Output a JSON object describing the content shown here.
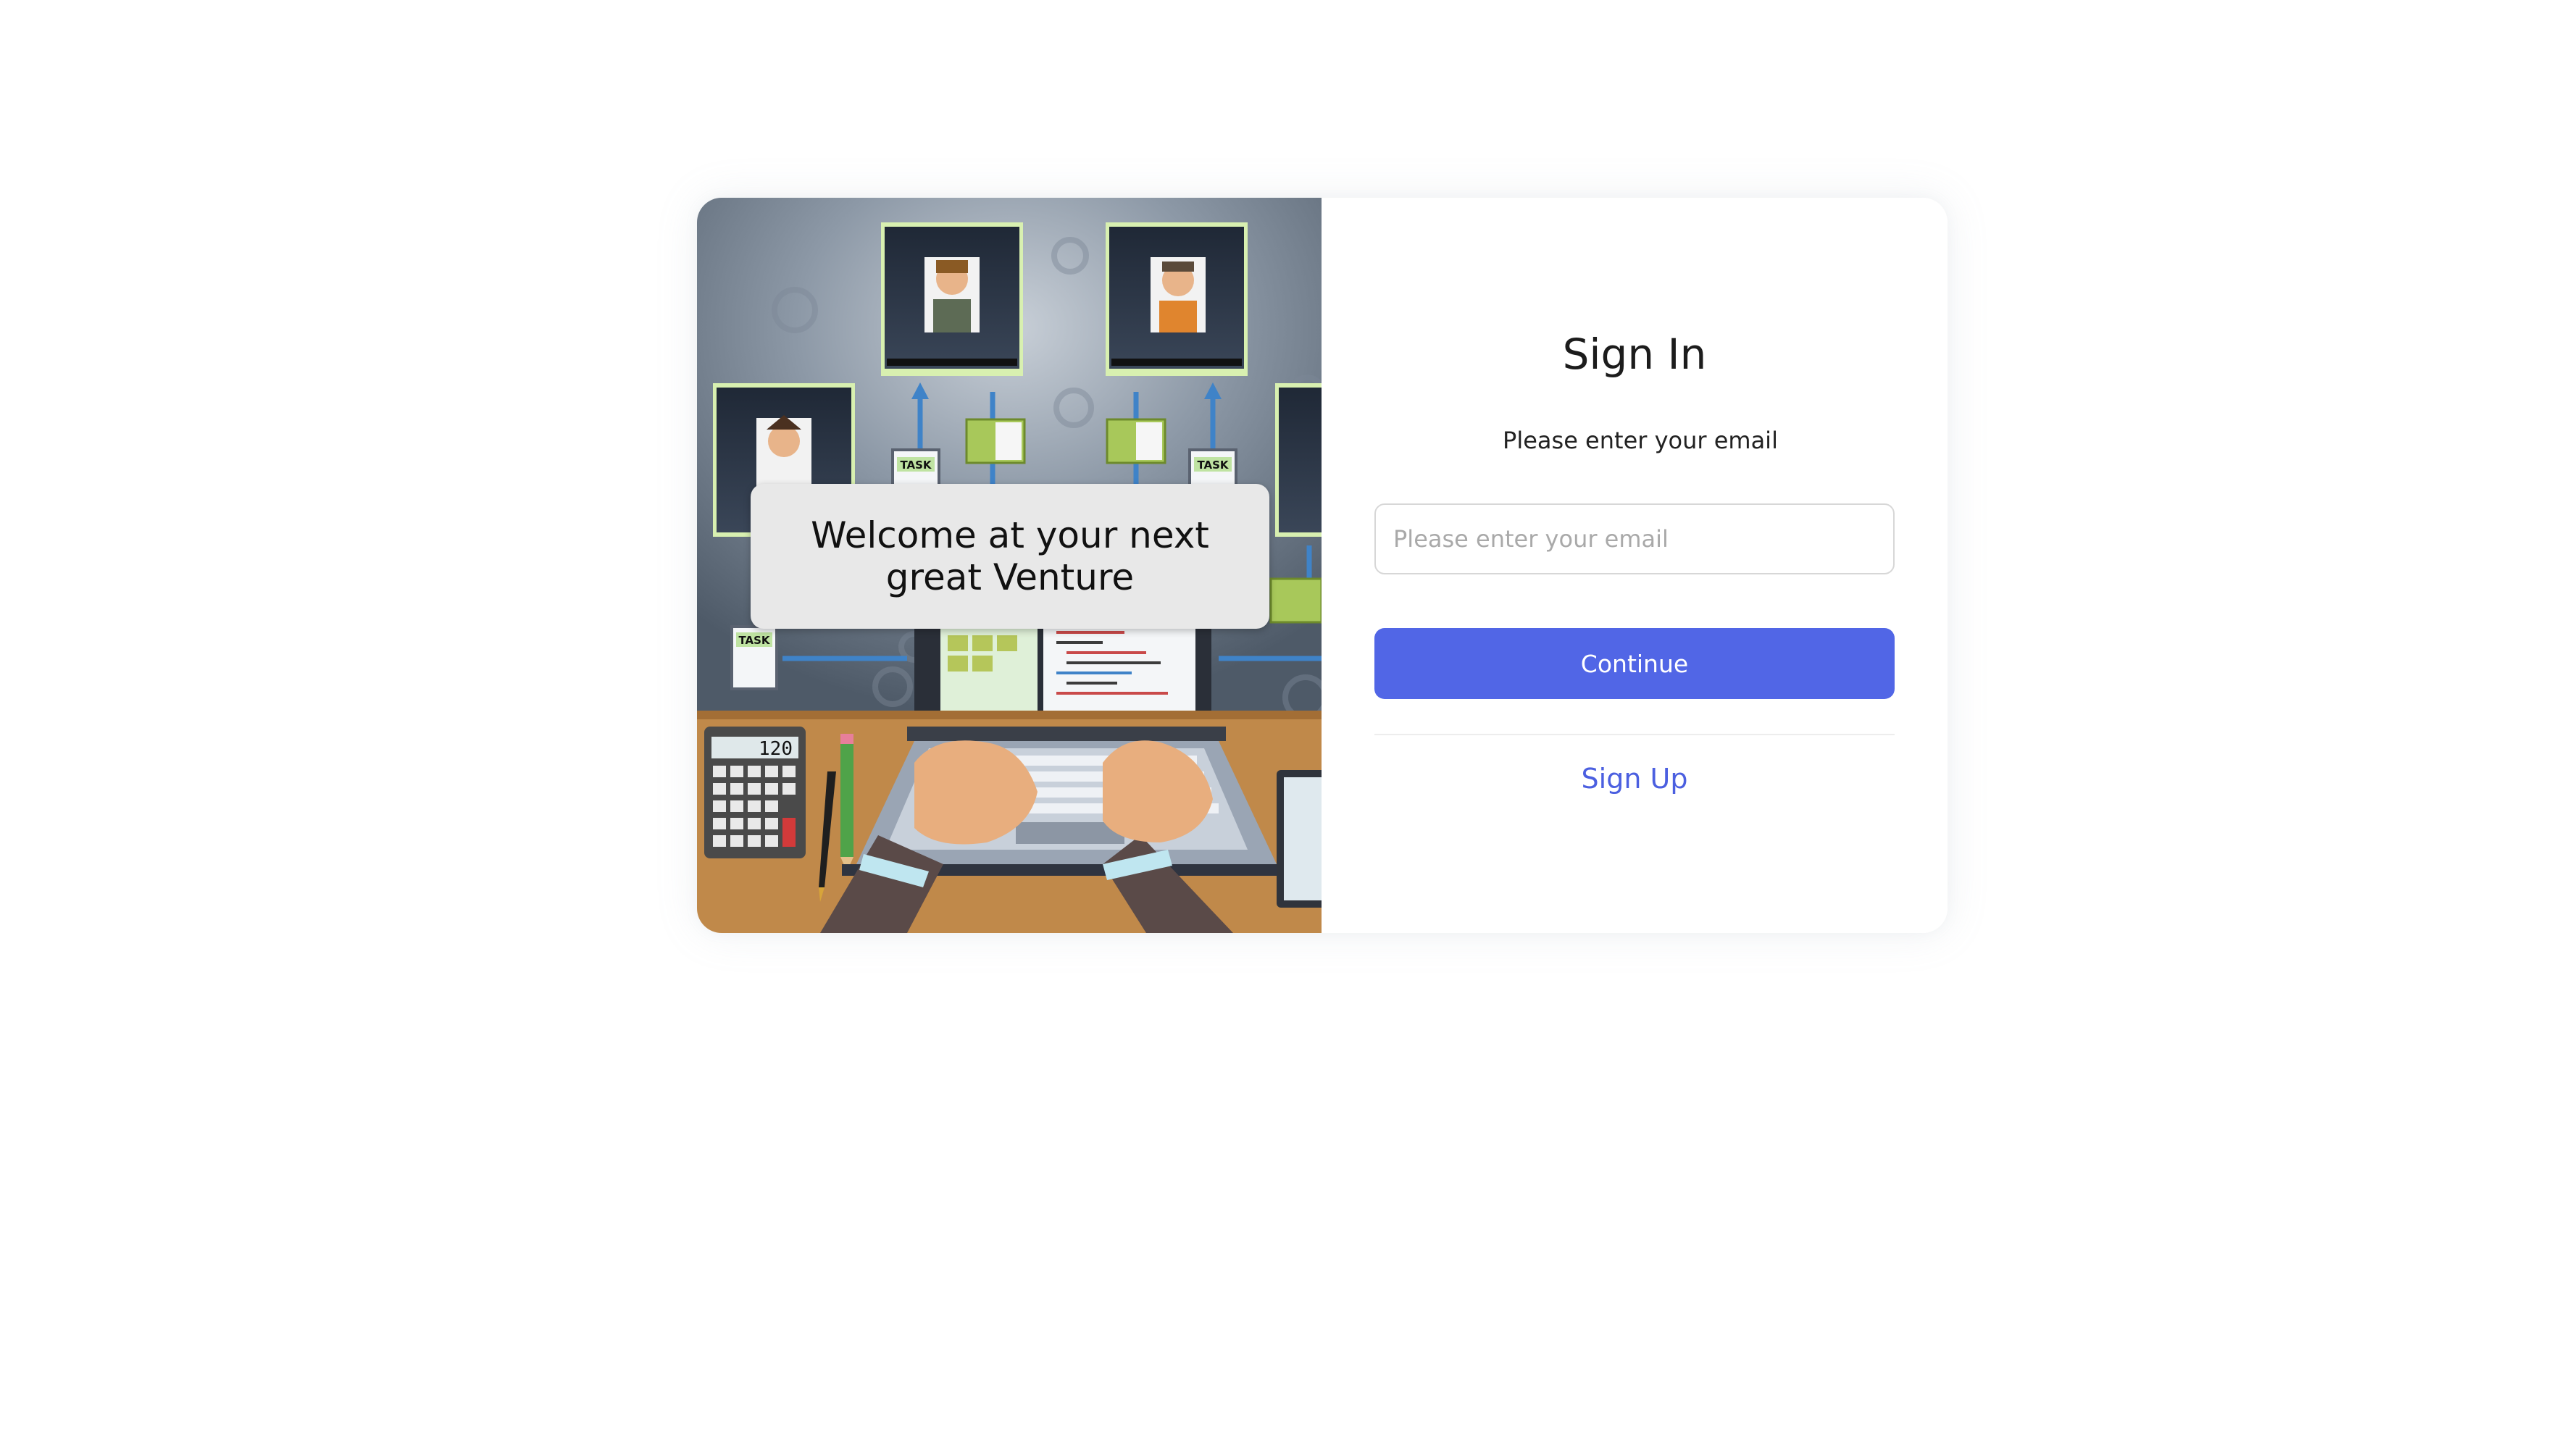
{
  "hero": {
    "welcome_text": "Welcome at your next great Venture",
    "calculator_display": "120",
    "task_label": "TASK"
  },
  "signin": {
    "title": "Sign In",
    "subtitle": "Please enter your email",
    "email_placeholder": "Please enter your email",
    "email_value": "",
    "continue_label": "Continue",
    "signup_label": "Sign Up"
  },
  "colors": {
    "primary": "#5166e6",
    "link": "#4b5fe0",
    "hero_wall": "#6e7c8c",
    "hero_desk": "#c0894a"
  }
}
